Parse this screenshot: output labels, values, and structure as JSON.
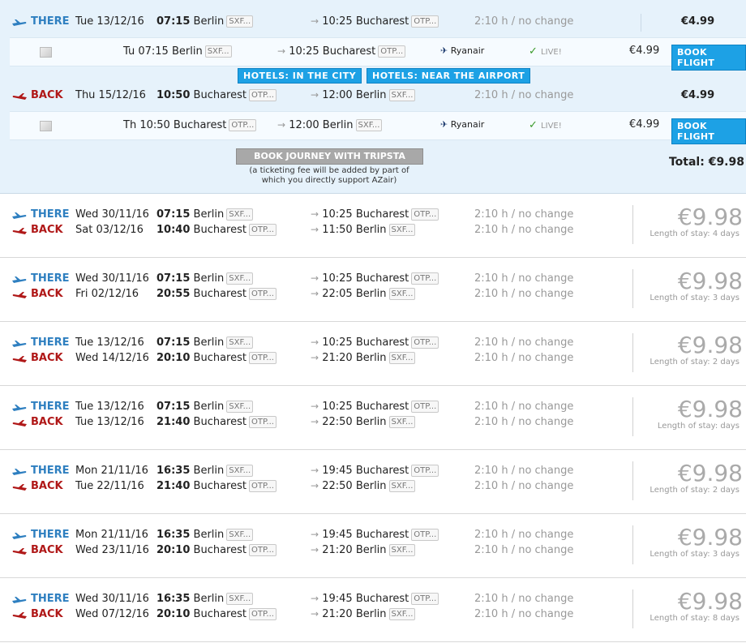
{
  "expanded": {
    "there": {
      "label": "THERE",
      "day": "Tue 13/12/16",
      "dep_time": "07:15",
      "dep_city": "Berlin",
      "dep_code": "SXF...",
      "arr_time": "10:25",
      "arr_city": "Bucharest",
      "arr_code": "OTP...",
      "duration": "2:10 h / no change",
      "price": "€4.99",
      "segment": {
        "day_time": "Tu 07:15",
        "dep_city": "Berlin",
        "dep_code": "SXF...",
        "arr": "10:25 Bucharest",
        "arr_code": "OTP...",
        "airline": "Ryanair",
        "status": "LIVE!",
        "price": "€4.99",
        "book": "BOOK FLIGHT"
      }
    },
    "hotels": {
      "city": "HOTELS: IN THE CITY",
      "airport": "HOTELS: NEAR THE AIRPORT"
    },
    "back": {
      "label": "BACK",
      "day": "Thu 15/12/16",
      "dep_time": "10:50",
      "dep_city": "Bucharest",
      "dep_code": "OTP...",
      "arr_time": "12:00",
      "arr_city": "Berlin",
      "arr_code": "SXF...",
      "duration": "2:10 h / no change",
      "price": "€4.99",
      "segment": {
        "day_time": "Th 10:50",
        "dep_city": "Bucharest",
        "dep_code": "OTP...",
        "arr": "12:00 Berlin",
        "arr_code": "SXF...",
        "airline": "Ryanair",
        "status": "LIVE!",
        "price": "€4.99",
        "book": "BOOK FLIGHT"
      }
    },
    "journey_button": "BOOK JOURNEY WITH TRIPSTA",
    "fee_note": "(a ticketing fee will be added by part of which you directly support AZair)",
    "total": "Total: €9.98"
  },
  "results": [
    {
      "there": {
        "day": "Wed 30/11/16",
        "dep_time": "07:15",
        "dep_city": "Berlin",
        "dep_code": "SXF...",
        "arr_time": "10:25",
        "arr_city": "Bucharest",
        "arr_code": "OTP...",
        "duration": "2:10 h / no change"
      },
      "back": {
        "day": "Sat 03/12/16",
        "dep_time": "10:40",
        "dep_city": "Bucharest",
        "dep_code": "OTP...",
        "arr_time": "11:50",
        "arr_city": "Berlin",
        "arr_code": "SXF...",
        "duration": "2:10 h / no change"
      },
      "price": "€9.98",
      "stay": "Length of stay: 4 days"
    },
    {
      "there": {
        "day": "Wed 30/11/16",
        "dep_time": "07:15",
        "dep_city": "Berlin",
        "dep_code": "SXF...",
        "arr_time": "10:25",
        "arr_city": "Bucharest",
        "arr_code": "OTP...",
        "duration": "2:10 h / no change"
      },
      "back": {
        "day": "Fri 02/12/16",
        "dep_time": "20:55",
        "dep_city": "Bucharest",
        "dep_code": "OTP...",
        "arr_time": "22:05",
        "arr_city": "Berlin",
        "arr_code": "SXF...",
        "duration": "2:10 h / no change"
      },
      "price": "€9.98",
      "stay": "Length of stay: 3 days"
    },
    {
      "there": {
        "day": "Tue 13/12/16",
        "dep_time": "07:15",
        "dep_city": "Berlin",
        "dep_code": "SXF...",
        "arr_time": "10:25",
        "arr_city": "Bucharest",
        "arr_code": "OTP...",
        "duration": "2:10 h / no change"
      },
      "back": {
        "day": "Wed 14/12/16",
        "dep_time": "20:10",
        "dep_city": "Bucharest",
        "dep_code": "OTP...",
        "arr_time": "21:20",
        "arr_city": "Berlin",
        "arr_code": "SXF...",
        "duration": "2:10 h / no change"
      },
      "price": "€9.98",
      "stay": "Length of stay: 2 days"
    },
    {
      "there": {
        "day": "Tue 13/12/16",
        "dep_time": "07:15",
        "dep_city": "Berlin",
        "dep_code": "SXF...",
        "arr_time": "10:25",
        "arr_city": "Bucharest",
        "arr_code": "OTP...",
        "duration": "2:10 h / no change"
      },
      "back": {
        "day": "Tue 13/12/16",
        "dep_time": "21:40",
        "dep_city": "Bucharest",
        "dep_code": "OTP...",
        "arr_time": "22:50",
        "arr_city": "Berlin",
        "arr_code": "SXF...",
        "duration": "2:10 h / no change"
      },
      "price": "€9.98",
      "stay": "Length of stay: days"
    },
    {
      "there": {
        "day": "Mon 21/11/16",
        "dep_time": "16:35",
        "dep_city": "Berlin",
        "dep_code": "SXF...",
        "arr_time": "19:45",
        "arr_city": "Bucharest",
        "arr_code": "OTP...",
        "duration": "2:10 h / no change"
      },
      "back": {
        "day": "Tue 22/11/16",
        "dep_time": "21:40",
        "dep_city": "Bucharest",
        "dep_code": "OTP...",
        "arr_time": "22:50",
        "arr_city": "Berlin",
        "arr_code": "SXF...",
        "duration": "2:10 h / no change"
      },
      "price": "€9.98",
      "stay": "Length of stay: 2 days"
    },
    {
      "there": {
        "day": "Mon 21/11/16",
        "dep_time": "16:35",
        "dep_city": "Berlin",
        "dep_code": "SXF...",
        "arr_time": "19:45",
        "arr_city": "Bucharest",
        "arr_code": "OTP...",
        "duration": "2:10 h / no change"
      },
      "back": {
        "day": "Wed 23/11/16",
        "dep_time": "20:10",
        "dep_city": "Bucharest",
        "dep_code": "OTP...",
        "arr_time": "21:20",
        "arr_city": "Berlin",
        "arr_code": "SXF...",
        "duration": "2:10 h / no change"
      },
      "price": "€9.98",
      "stay": "Length of stay: 3 days"
    },
    {
      "there": {
        "day": "Wed 30/11/16",
        "dep_time": "16:35",
        "dep_city": "Berlin",
        "dep_code": "SXF...",
        "arr_time": "19:45",
        "arr_city": "Bucharest",
        "arr_code": "OTP...",
        "duration": "2:10 h / no change"
      },
      "back": {
        "day": "Wed 07/12/16",
        "dep_time": "20:10",
        "dep_city": "Bucharest",
        "dep_code": "OTP...",
        "arr_time": "21:20",
        "arr_city": "Berlin",
        "arr_code": "SXF...",
        "duration": "2:10 h / no change"
      },
      "price": "€9.98",
      "stay": "Length of stay: 8 days"
    }
  ],
  "labels": {
    "there": "THERE",
    "back": "BACK"
  },
  "colors": {
    "there": "#2e7fc0",
    "back": "#b01818",
    "button": "#1da1e5"
  }
}
